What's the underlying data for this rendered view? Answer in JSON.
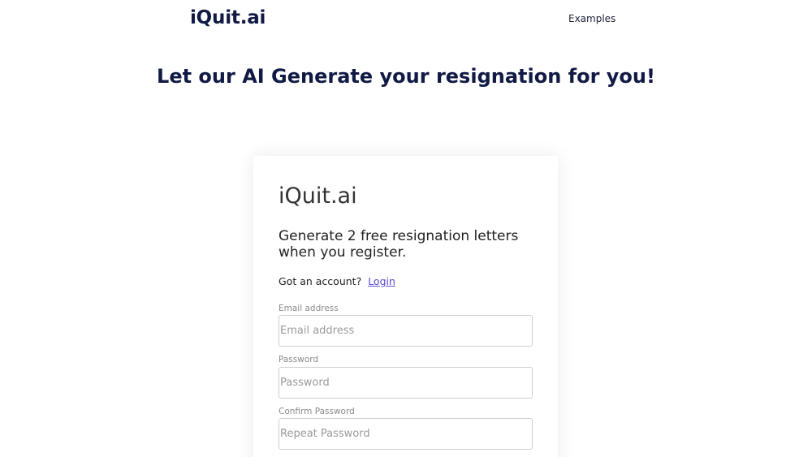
{
  "header": {
    "brand": "iQuit.ai",
    "nav_examples": "Examples"
  },
  "hero": {
    "headline": "Let our AI Generate your resignation for you!"
  },
  "card": {
    "title": "iQuit.ai",
    "subtitle": "Generate 2 free resignation letters when you register.",
    "account_prompt": "Got an account?",
    "login_link": "Login",
    "fields": [
      {
        "label": "Email address",
        "placeholder": "Email address"
      },
      {
        "label": "Password",
        "placeholder": "Password"
      },
      {
        "label": "Confirm Password",
        "placeholder": "Repeat Password"
      }
    ]
  }
}
